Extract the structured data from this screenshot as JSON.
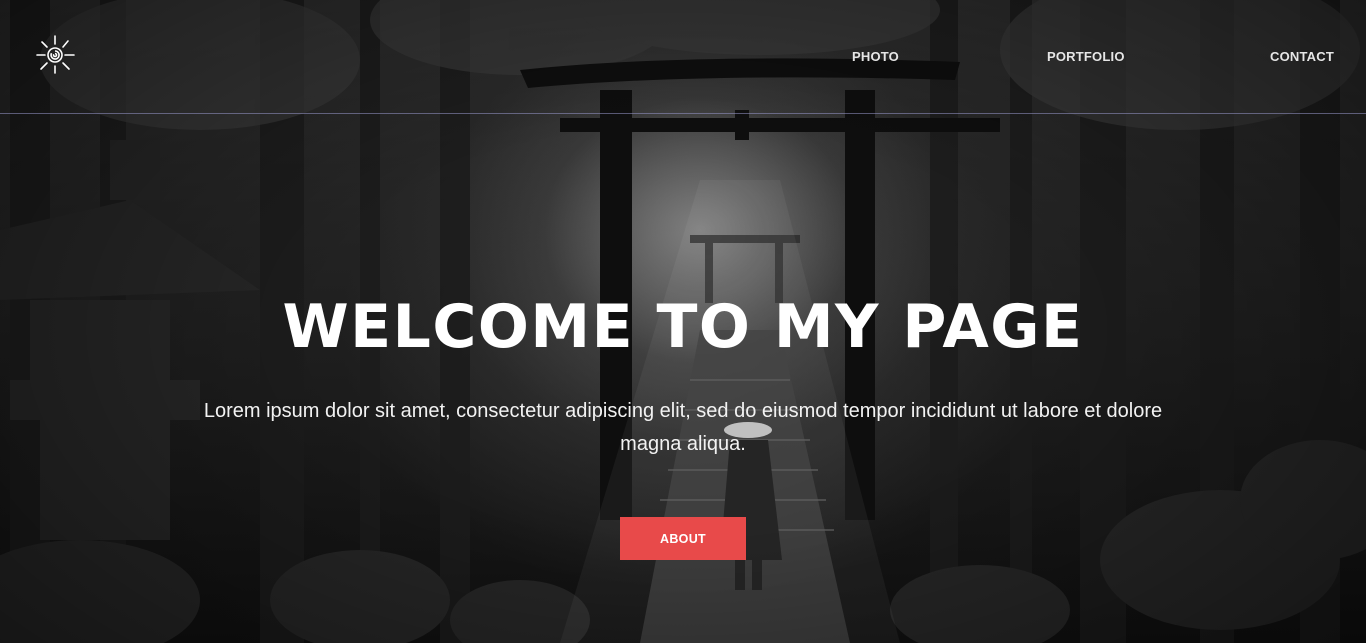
{
  "nav": {
    "logo_icon": "spiral-sun-icon",
    "links": [
      "PHOTO",
      "PORTFOLIO",
      "CONTACT"
    ]
  },
  "hero": {
    "title": "WELCOME TO MY PAGE",
    "text": "Lorem ipsum dolor sit amet, consectetur adipiscing elit, sed do eiusmod tempor incididunt ut labore et dolore magna aliqua.",
    "button_label": "ABOUT",
    "background_image": "dark-forest-torii-gate-photo"
  },
  "colors": {
    "accent": "#e84a4a",
    "nav_text": "#e6e6e6",
    "divider": "#9696c8"
  }
}
